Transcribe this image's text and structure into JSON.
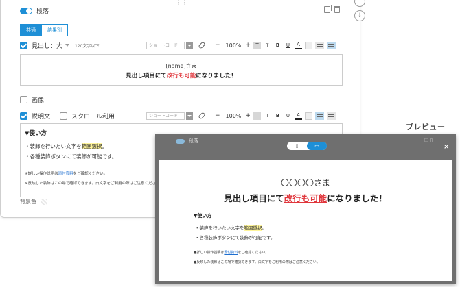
{
  "block": {
    "title": "段落"
  },
  "tabs": [
    {
      "label": "共通",
      "active": true
    },
    {
      "label": "結果別",
      "active": false
    }
  ],
  "headline_row": {
    "label": "見出し：大",
    "note": "120文字以下"
  },
  "toolbar": {
    "shortcode_placeholder": "ショートコード",
    "zoom": "100%",
    "minus": "−",
    "plus": "+",
    "btn_T_large": "T",
    "btn_T_small": "T",
    "btn_B": "B",
    "btn_U": "U",
    "btn_A": "A"
  },
  "headline_box": {
    "line1": "[name]さま",
    "line2_pre": "見出し項目にて",
    "line2_red": "改行も可能",
    "line2_post": "になりました！"
  },
  "image_row": {
    "label": "画像"
  },
  "desc_row": {
    "label": "説明文",
    "scroll_label": "スクロール利用"
  },
  "desc_box": {
    "head": "▼使い方",
    "item1_pre": "・装飾を行いたい文字を",
    "item1_hl": "範囲選択",
    "item1_post": "。",
    "item2": "・各種装飾ボタンにて装飾が可能です。",
    "note1_pre": "※詳しい操作説明は",
    "note1_link": "添付資料",
    "note1_post": "をご確認ください。",
    "note2": "※反映した装飾はこの場で確認できます。白文字をご利用の際はご注意ください。"
  },
  "bg_row": {
    "label": "背景色"
  },
  "preview": {
    "label": "プレビュー",
    "bg_title": "段落",
    "switch": [
      {
        "label": "▯",
        "icon": "mobile-icon",
        "active": false
      },
      {
        "label": "▭",
        "icon": "laptop-icon",
        "active": true
      }
    ],
    "close": "×",
    "line1": "〇〇〇〇さま",
    "line2_pre": "見出し項目にて",
    "line2_red": "改行も可能",
    "line2_post": "になりました！",
    "head": "▼使い方",
    "item1_pre": "・装飾を行いたい文字を",
    "item1_hl": "範囲選択",
    "item1_post": "。",
    "item2": "・各種装飾ボタンにて装飾が可能です。",
    "note1_pre": "●詳しい操作説明は",
    "note1_link": "添付資料",
    "note1_post": "をご確認ください。",
    "note2": "●反映した装飾はこの場で確認できます。白文字をご利用の際はご注意ください。"
  },
  "colors": {
    "accent": "#1e8fd6",
    "red": "#e0363c",
    "highlight": "#fff59a",
    "link": "#1e6fd0"
  }
}
